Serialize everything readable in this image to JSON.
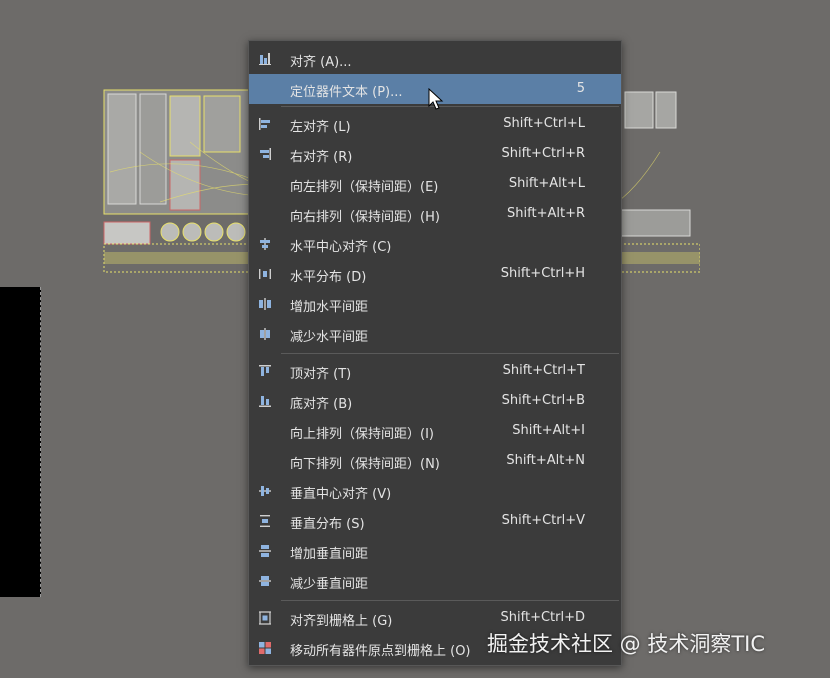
{
  "menu": {
    "items": [
      {
        "label": "对齐 (A)...",
        "shortcut": "",
        "icon": "align-icon",
        "highlighted": false
      },
      {
        "label": "定位器件文本 (P)...",
        "shortcut": "5",
        "icon": "",
        "highlighted": true
      },
      {
        "label": "左对齐 (L)",
        "shortcut": "Shift+Ctrl+L",
        "icon": "align-left-icon",
        "highlighted": false
      },
      {
        "label": "右对齐 (R)",
        "shortcut": "Shift+Ctrl+R",
        "icon": "align-right-icon",
        "highlighted": false
      },
      {
        "label": "向左排列（保持间距）(E)",
        "shortcut": "Shift+Alt+L",
        "icon": "",
        "highlighted": false
      },
      {
        "label": "向右排列（保持间距）(H)",
        "shortcut": "Shift+Alt+R",
        "icon": "",
        "highlighted": false
      },
      {
        "label": "水平中心对齐 (C)",
        "shortcut": "",
        "icon": "align-horizontal-center-icon",
        "highlighted": false
      },
      {
        "label": "水平分布 (D)",
        "shortcut": "Shift+Ctrl+H",
        "icon": "distribute-horizontal-icon",
        "highlighted": false
      },
      {
        "label": "增加水平间距",
        "shortcut": "",
        "icon": "increase-horizontal-spacing-icon",
        "highlighted": false
      },
      {
        "label": "减少水平间距",
        "shortcut": "",
        "icon": "decrease-horizontal-spacing-icon",
        "highlighted": false
      },
      {
        "label": "顶对齐 (T)",
        "shortcut": "Shift+Ctrl+T",
        "icon": "align-top-icon",
        "highlighted": false
      },
      {
        "label": "底对齐 (B)",
        "shortcut": "Shift+Ctrl+B",
        "icon": "align-bottom-icon",
        "highlighted": false
      },
      {
        "label": "向上排列（保持间距）(I)",
        "shortcut": "Shift+Alt+I",
        "icon": "",
        "highlighted": false
      },
      {
        "label": "向下排列（保持间距）(N)",
        "shortcut": "Shift+Alt+N",
        "icon": "",
        "highlighted": false
      },
      {
        "label": "垂直中心对齐 (V)",
        "shortcut": "",
        "icon": "align-vertical-center-icon",
        "highlighted": false
      },
      {
        "label": "垂直分布 (S)",
        "shortcut": "Shift+Ctrl+V",
        "icon": "distribute-vertical-icon",
        "highlighted": false
      },
      {
        "label": "增加垂直间距",
        "shortcut": "",
        "icon": "increase-vertical-spacing-icon",
        "highlighted": false
      },
      {
        "label": "减少垂直间距",
        "shortcut": "",
        "icon": "decrease-vertical-spacing-icon",
        "highlighted": false
      },
      {
        "label": "对齐到栅格上 (G)",
        "shortcut": "Shift+Ctrl+D",
        "icon": "align-to-grid-icon",
        "highlighted": false
      },
      {
        "label": "移动所有器件原点到栅格上 (O)",
        "shortcut": "",
        "icon": "move-origins-to-grid-icon",
        "highlighted": false
      }
    ]
  },
  "watermark": "掘金技术社区 @ 技术洞察TIC",
  "colors": {
    "background": "#6d6b69",
    "menu_bg": "#3b3b3b",
    "highlight": "#5b7fa6",
    "pcb_outline": "#e8e06a",
    "icon_blue": "#8fb4e0"
  }
}
